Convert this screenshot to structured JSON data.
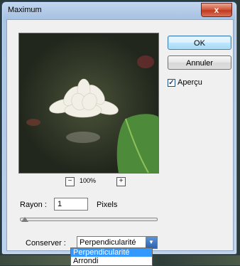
{
  "window": {
    "title": "Maximum",
    "close_glyph": "x"
  },
  "preview": {
    "zoom_out_glyph": "−",
    "zoom_in_glyph": "+",
    "zoom_level": "100%"
  },
  "buttons": {
    "ok": "OK",
    "cancel": "Annuler"
  },
  "apercu": {
    "label": "Aperçu",
    "checked": true,
    "check_glyph": "✓"
  },
  "rayon": {
    "label": "Rayon :",
    "value": "1",
    "unit": "Pixels",
    "slider_fraction": 0.0
  },
  "conserver": {
    "label": "Conserver :",
    "selected": "Perpendicularité",
    "arrow_glyph": "▼",
    "options": [
      "Perpendicularité",
      "Arrondi"
    ]
  },
  "colors": {
    "title_gradient": "#a9c3e3",
    "close_button": "#c03a20",
    "selection": "#3399ff",
    "ok_border": "#3c7fb1"
  }
}
